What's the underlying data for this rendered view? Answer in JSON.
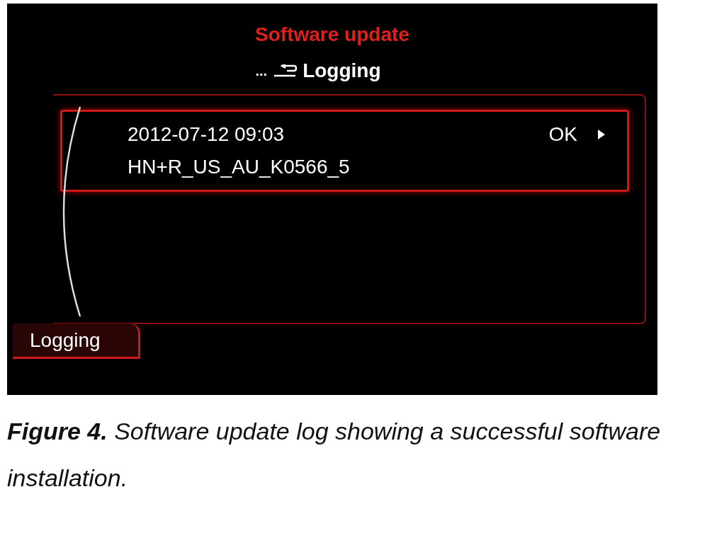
{
  "screen": {
    "title": "Software update",
    "breadcrumb": {
      "ellipsis": "...",
      "current": "Logging"
    },
    "entries": [
      {
        "date": "2012-07-12 09:03",
        "status": "OK",
        "name": "HN+R_US_AU_K0566_5",
        "selected": true
      }
    ],
    "tab": {
      "label": "Logging",
      "selected": true
    }
  },
  "caption": {
    "text": "**Figure 4.** Software update log showing a successful software installation."
  }
}
